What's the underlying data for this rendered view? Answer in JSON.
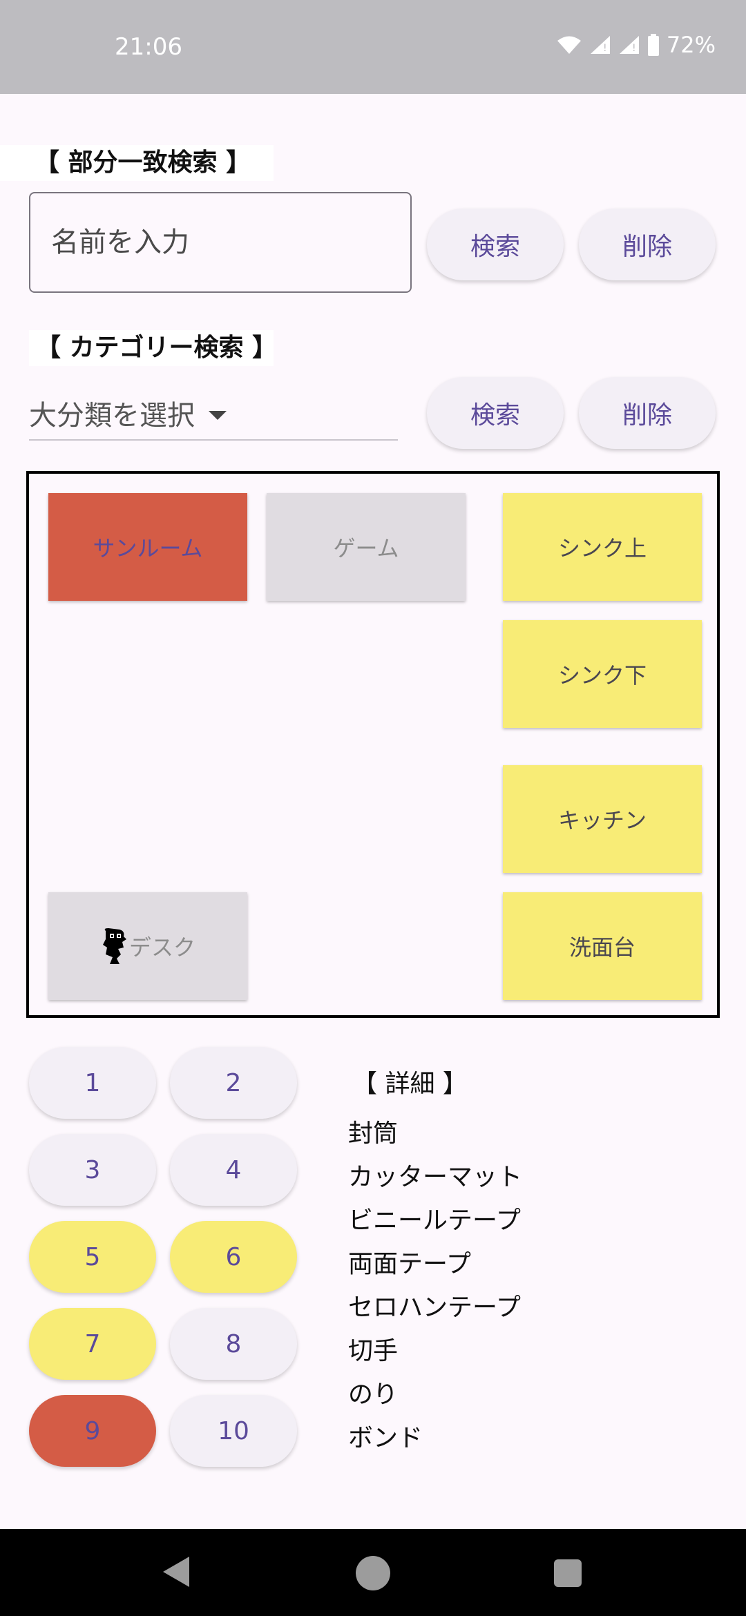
{
  "status_bar": {
    "time": "21:06",
    "battery": "72%",
    "icons": [
      "wifi-icon",
      "signal-icon",
      "signal-icon",
      "battery-icon"
    ]
  },
  "partial_search": {
    "label": "【 部分一致検索 】",
    "input_placeholder": "名前を入力",
    "search_label": "検索",
    "delete_label": "削除"
  },
  "category_search": {
    "label": "【 カテゴリー検索 】",
    "dropdown_value": "大分類を選択",
    "search_label": "検索",
    "delete_label": "削除"
  },
  "map": {
    "tiles": [
      {
        "label": "サンルーム",
        "state": "red"
      },
      {
        "label": "ゲーム",
        "state": "gray"
      },
      {
        "label": "シンク上",
        "state": "yellow"
      },
      {
        "label": "シンク下",
        "state": "yellow"
      },
      {
        "label": "キッチン",
        "state": "yellow"
      },
      {
        "label": "デスク",
        "state": "gray"
      },
      {
        "label": "洗面台",
        "state": "yellow"
      }
    ]
  },
  "numbers": [
    {
      "label": "1",
      "state": "default"
    },
    {
      "label": "2",
      "state": "default"
    },
    {
      "label": "3",
      "state": "default"
    },
    {
      "label": "4",
      "state": "default"
    },
    {
      "label": "5",
      "state": "yellow"
    },
    {
      "label": "6",
      "state": "yellow"
    },
    {
      "label": "7",
      "state": "yellow"
    },
    {
      "label": "8",
      "state": "default"
    },
    {
      "label": "9",
      "state": "red"
    },
    {
      "label": "10",
      "state": "default"
    }
  ],
  "details": {
    "title": "【 詳細 】",
    "items": [
      "封筒",
      "カッターマット",
      "ビニールテープ",
      "両面テープ",
      "セロハンテープ",
      "切手",
      "のり",
      "ボンド"
    ]
  },
  "colors": {
    "red": "#d45c46",
    "yellow": "#f8ec76",
    "gray": "#e0dce1",
    "accent_text": "#5b4a9a"
  }
}
